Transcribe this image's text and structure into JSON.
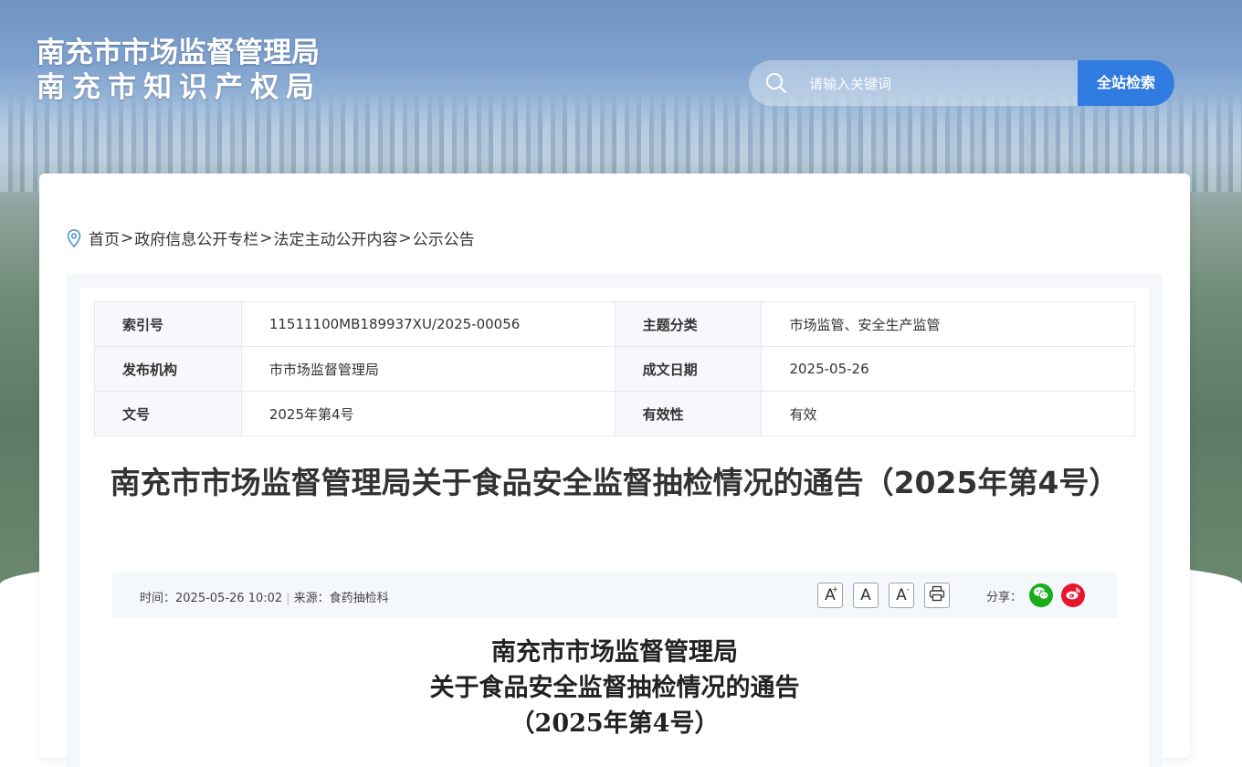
{
  "site": {
    "title_line1": "南充市市场监督管理局",
    "title_line2": "南充市知识产权局"
  },
  "search": {
    "placeholder": "请输入关键词",
    "button_label": "全站检索"
  },
  "breadcrumb": {
    "items": [
      "首页",
      "政府信息公开专栏",
      "法定主动公开内容",
      "公示公告"
    ],
    "separator": ">"
  },
  "meta": {
    "rows": [
      {
        "k1": "索引号",
        "v1": "11511100MB189937XU/2025-00056",
        "k2": "主题分类",
        "v2": "市场监管、安全生产监管"
      },
      {
        "k1": "发布机构",
        "v1": "市市场监督管理局",
        "k2": "成文日期",
        "v2": "2025-05-26"
      },
      {
        "k1": "文号",
        "v1": "2025年第4号",
        "k2": "有效性",
        "v2": "有效"
      }
    ]
  },
  "article": {
    "title": "南充市市场监督管理局关于食品安全监督抽检情况的通告（2025年第4号）",
    "time_label": "时间：",
    "time": "2025-05-26 10:02",
    "source_label": "来源：",
    "source": "食药抽检科",
    "share_label": "分享：",
    "doc_line1": "南充市市场监督管理局",
    "doc_line2": "关于食品安全监督抽检情况的通告",
    "doc_line3": "（2025年第4号）"
  },
  "tools": {
    "font_large": "A",
    "font_normal": "A",
    "font_small": "A",
    "plus_mark": "+",
    "minus_mark": "-"
  },
  "colors": {
    "accent": "#2f7be0",
    "wechat": "#1aad19",
    "weibo": "#e6162d"
  }
}
